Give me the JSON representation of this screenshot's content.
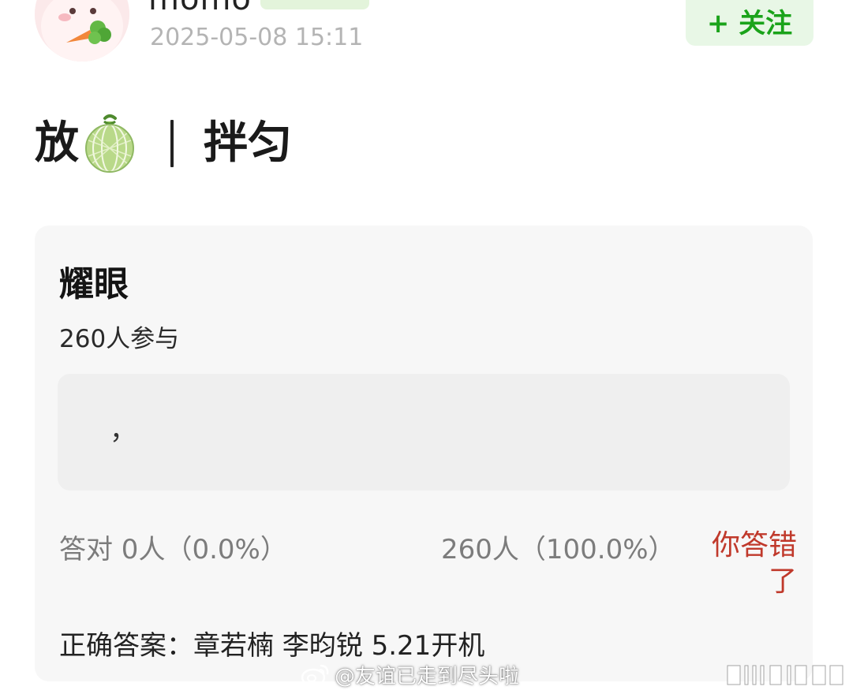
{
  "header": {
    "username": "momo",
    "post_time": "2025-05-08 15:11",
    "follow_label": "+ 关注"
  },
  "post": {
    "title_before": "放",
    "title_icon": "melon-icon",
    "title_after": "拌匀"
  },
  "quiz": {
    "question": "耀眼",
    "participants": "260人参与",
    "option_text": "，",
    "correct_stat": "答对  0人（0.0%）",
    "wrong_stat": "260人（100.0%）",
    "wrong_message": "你答错了",
    "answer": "正确答案：章若楠 李昀锐 5.21开机"
  },
  "watermark": {
    "text": "@友谊已走到尽头啦",
    "icon": "weibo-icon"
  },
  "colors": {
    "accent_green": "#1aa31a",
    "follow_bg": "#e8f7e6",
    "error_red": "#c0392b",
    "card_bg": "#f7f7f7"
  }
}
